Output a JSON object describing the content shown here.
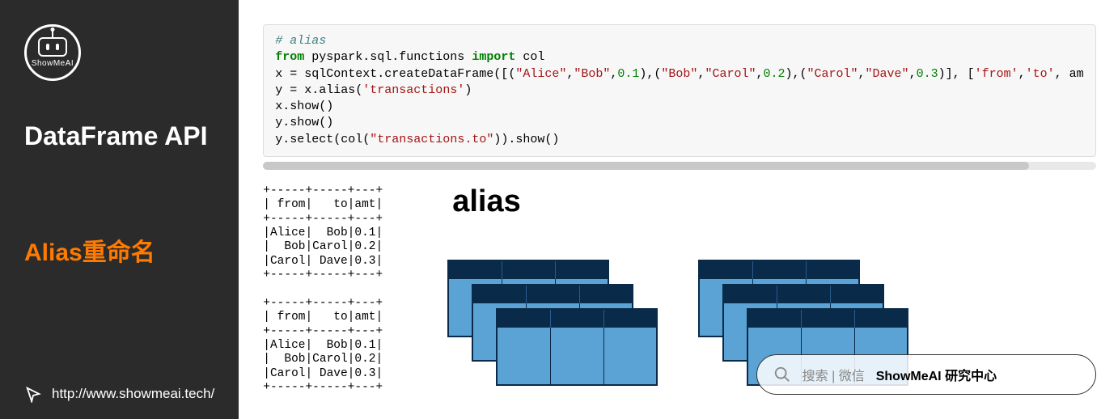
{
  "sidebar": {
    "logo_text": "ShowMeAI",
    "title": "DataFrame API",
    "subtitle": "Alias重命名",
    "url": "http://www.showmeai.tech/"
  },
  "code": {
    "comment": "# alias",
    "line2_from": "from",
    "line2_mod": " pyspark.sql.functions ",
    "line2_import": "import",
    "line2_col": " col",
    "line3_a": "x = sqlContext.createDataFrame([(",
    "line3_s1": "\"Alice\"",
    "line3_c1": ",",
    "line3_s2": "\"Bob\"",
    "line3_c2": ",",
    "line3_n1": "0.1",
    "line3_c3": "),(",
    "line3_s3": "\"Bob\"",
    "line3_c4": ",",
    "line3_s4": "\"Carol\"",
    "line3_c5": ",",
    "line3_n2": "0.2",
    "line3_c6": "),(",
    "line3_s5": "\"Carol\"",
    "line3_c7": ",",
    "line3_s6": "\"Dave\"",
    "line3_c8": ",",
    "line3_n3": "0.3",
    "line3_c9": ")], [",
    "line3_s7": "'from'",
    "line3_c10": ",",
    "line3_s8": "'to'",
    "line3_c11": ", am",
    "line4_a": "y = x.alias(",
    "line4_s": "'transactions'",
    "line4_b": ")",
    "line5": "x.show()",
    "line6": "y.show()",
    "line7_a": "y.select(col(",
    "line7_s": "\"transactions.to\"",
    "line7_b": ")).show()"
  },
  "table1": "+-----+-----+---+\n| from|   to|amt|\n+-----+-----+---+\n|Alice|  Bob|0.1|\n|  Bob|Carol|0.2|\n|Carol| Dave|0.3|\n+-----+-----+---+",
  "table2": "+-----+-----+---+\n| from|   to|amt|\n+-----+-----+---+\n|Alice|  Bob|0.1|\n|  Bob|Carol|0.2|\n|Carol| Dave|0.3|\n+-----+-----+---+",
  "alias_title": "alias",
  "watermark": "ShowMeAI",
  "search": {
    "label1": "搜索 | 微信",
    "label2": "ShowMeAI 研究中心"
  }
}
